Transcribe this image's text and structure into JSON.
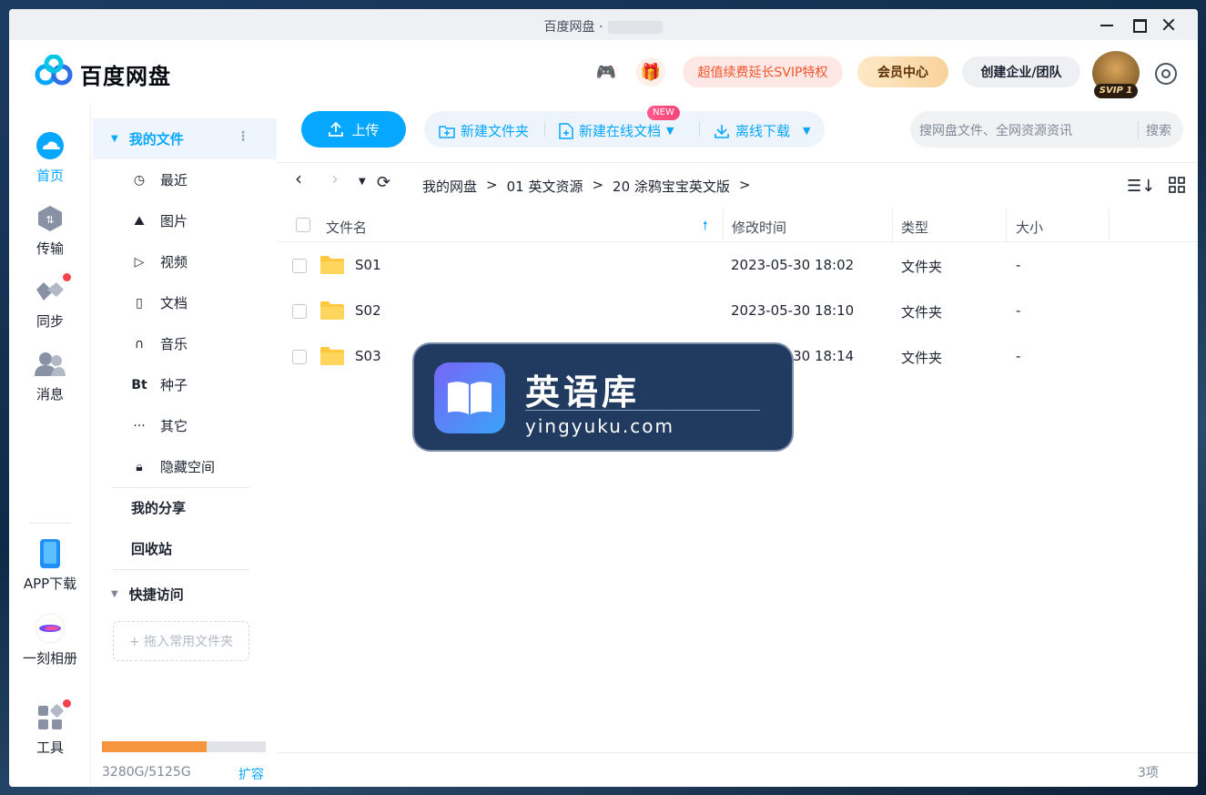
{
  "window": {
    "title": "百度网盘 ·",
    "controls": {
      "minimize_icon": "minimize-icon",
      "maximize_icon": "maximize-icon",
      "close_icon": "close-icon"
    }
  },
  "header": {
    "logo_text": "百度网盘",
    "svip_promo": "超值续费延长SVIP特权",
    "vip_center": "会员中心",
    "enterprise": "创建企业/团队",
    "avatar_badge": "SVIP 1",
    "colors": {
      "accent": "#06a7ff",
      "promo": "#f0542a",
      "vip_gold": "#f9d29b"
    }
  },
  "leftnav": {
    "items": [
      {
        "label": "首页",
        "icon": "cloud-icon"
      },
      {
        "label": "传输",
        "icon": "transfer-icon"
      },
      {
        "label": "同步",
        "icon": "sync-icon"
      },
      {
        "label": "消息",
        "icon": "message-icon"
      }
    ],
    "bottom": [
      {
        "label": "APP下载",
        "icon": "phone-icon"
      },
      {
        "label": "一刻相册",
        "icon": "album-icon"
      },
      {
        "label": "工具",
        "icon": "tools-icon"
      }
    ]
  },
  "categories": {
    "my_files": "我的文件",
    "items": [
      {
        "label": "最近",
        "icon": "clock-icon"
      },
      {
        "label": "图片",
        "icon": "image-icon"
      },
      {
        "label": "视频",
        "icon": "play-icon"
      },
      {
        "label": "文档",
        "icon": "document-icon"
      },
      {
        "label": "音乐",
        "icon": "headphone-icon"
      },
      {
        "label": "种子",
        "icon": "bt-icon"
      },
      {
        "label": "其它",
        "icon": "more-icon"
      },
      {
        "label": "隐藏空间",
        "icon": "lock-icon"
      }
    ],
    "my_share": "我的分享",
    "recycle": "回收站",
    "quick_access": "快捷访问",
    "drop_hint": "+ 拖入常用文件夹",
    "quota_text": "3280G/5125G",
    "quota_used_fraction": 0.64,
    "expand": "扩容"
  },
  "toolbar": {
    "upload": "上传",
    "new_folder": "新建文件夹",
    "new_online_doc": "新建在线文档",
    "new_badge": "NEW",
    "offline_download": "离线下载",
    "search_placeholder": "搜网盘文件、全网资源资讯",
    "search_button": "搜索"
  },
  "breadcrumb": [
    "我的网盘",
    ">",
    "01 英文资源",
    ">",
    "20 涂鸦宝宝英文版",
    ">"
  ],
  "table": {
    "headers": {
      "name": "文件名",
      "modified": "修改时间",
      "type": "类型",
      "size": "大小"
    },
    "rows": [
      {
        "name": "S01",
        "modified": "2023-05-30 18:02",
        "type": "文件夹",
        "size": "-"
      },
      {
        "name": "S02",
        "modified": "2023-05-30 18:10",
        "type": "文件夹",
        "size": "-"
      },
      {
        "name": "S03",
        "modified": "2023-05-30 18:14",
        "type": "文件夹",
        "size": "-"
      }
    ],
    "count": "3项"
  },
  "watermark": {
    "title": "英语库",
    "url": "yingyuku.com"
  }
}
